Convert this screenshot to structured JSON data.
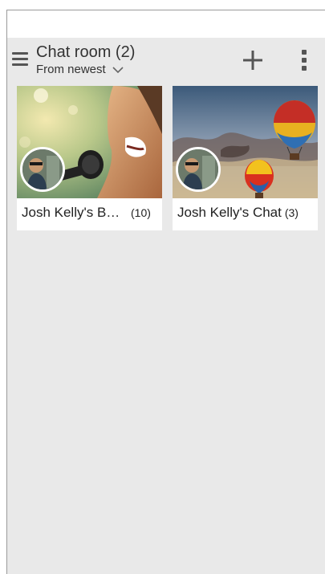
{
  "header": {
    "title": "Chat room (2)",
    "sort_label": "From newest"
  },
  "icons": {
    "menu": "hamburger-menu-icon",
    "sort": "chevron-down-icon",
    "add": "plus-icon",
    "more": "more-vertical-icon"
  },
  "colors": {
    "appbar_bg": "#e9e9e9",
    "card_bg": "#ffffff",
    "text": "#222222",
    "icon": "#555555"
  },
  "rooms": [
    {
      "name": "Josh Kelly's Ba…",
      "count": "(10)",
      "image": "singer-with-microphone"
    },
    {
      "name": "Josh Kelly's Chat",
      "count": "(3)",
      "image": "hot-air-balloons-sky"
    }
  ]
}
